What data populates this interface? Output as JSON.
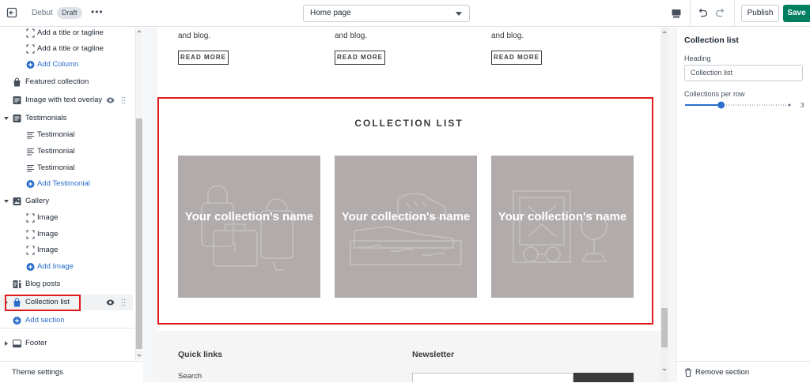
{
  "topbar": {
    "theme_name": "Debut",
    "status_badge": "Draft",
    "page_selector": "Home page",
    "publish_label": "Publish",
    "save_label": "Save"
  },
  "sidebar": {
    "items": [
      {
        "label": "Add a title or tagline",
        "icon": "placeholder-frame-icon"
      },
      {
        "label": "Add a title or tagline",
        "icon": "placeholder-frame-icon"
      },
      {
        "label": "Add Column",
        "icon": "plus-circle-icon"
      },
      {
        "label": "Featured collection",
        "icon": "shopping-bag-icon"
      },
      {
        "label": "Image with text overlay",
        "icon": "text-block-icon"
      },
      {
        "label": "Testimonials",
        "icon": "text-block-icon"
      },
      {
        "label": "Testimonial",
        "icon": "text-lines-icon"
      },
      {
        "label": "Testimonial",
        "icon": "text-lines-icon"
      },
      {
        "label": "Testimonial",
        "icon": "text-lines-icon"
      },
      {
        "label": "Add Testimonial",
        "icon": "plus-circle-icon"
      },
      {
        "label": "Gallery",
        "icon": "image-icon"
      },
      {
        "label": "Image",
        "icon": "placeholder-frame-icon"
      },
      {
        "label": "Image",
        "icon": "placeholder-frame-icon"
      },
      {
        "label": "Image",
        "icon": "placeholder-frame-icon"
      },
      {
        "label": "Add Image",
        "icon": "plus-circle-icon"
      },
      {
        "label": "Blog posts",
        "icon": "blog-icon"
      },
      {
        "label": "Collection list",
        "icon": "shopping-bag-icon"
      },
      {
        "label": "Add section",
        "icon": "plus-circle-icon"
      },
      {
        "label": "Footer",
        "icon": "footer-icon"
      }
    ],
    "theme_settings": "Theme settings"
  },
  "preview": {
    "blog_snippets": [
      "and blog.",
      "and blog.",
      "and blog."
    ],
    "read_more": "READ MORE",
    "collection_title": "COLLECTION LIST",
    "collections": [
      {
        "name": "Your collection's name",
        "illustration": "bags-illustration"
      },
      {
        "name": "Your collection's name",
        "illustration": "shoes-illustration"
      },
      {
        "name": "Your collection's name",
        "illustration": "sunglasses-illustration"
      }
    ],
    "footer": {
      "quick_links_heading": "Quick links",
      "newsletter_heading": "Newsletter",
      "first_link": "Search"
    }
  },
  "settings_panel": {
    "title": "Collection list",
    "heading_label": "Heading",
    "heading_value": "Collection list",
    "per_row_label": "Collections per row",
    "per_row_value": "3",
    "per_row_fraction": 0.333,
    "remove_label": "Remove section"
  },
  "colors": {
    "accent_blue": "#2c6ecb",
    "save_green": "#008060",
    "highlight_red": "#e01b1b",
    "card_gray": "#b2abab"
  }
}
